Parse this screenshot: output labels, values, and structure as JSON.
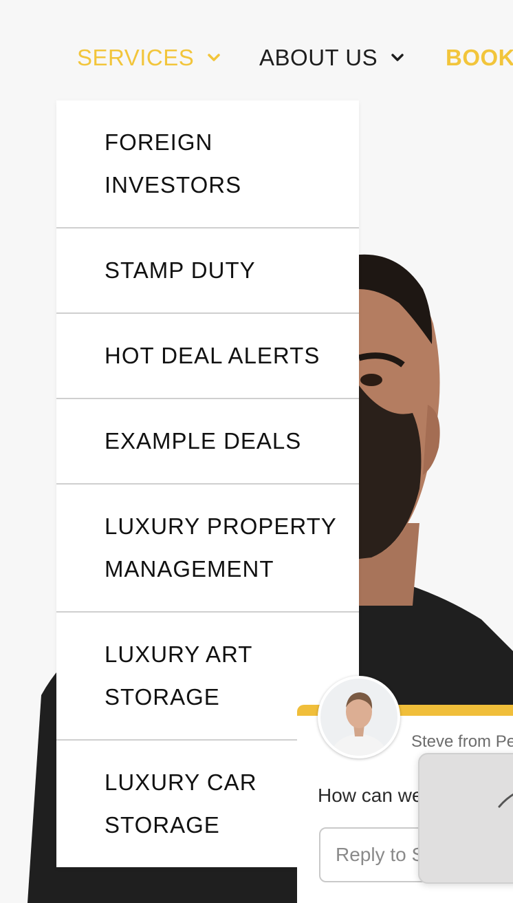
{
  "nav": {
    "services": "SERVICES",
    "about": "ABOUT US",
    "book": "BOOK"
  },
  "services_menu": {
    "items": [
      {
        "line1": "FOREIGN",
        "line2": "INVESTORS"
      },
      {
        "line1": "STAMP DUTY",
        "line2": ""
      },
      {
        "line1": "HOT DEAL ALERTS",
        "line2": ""
      },
      {
        "line1": "EXAMPLE DEALS",
        "line2": ""
      },
      {
        "line1": "LUXURY PROPERTY",
        "line2": "MANAGEMENT"
      },
      {
        "line1": "LUXURY ART",
        "line2": "STORAGE"
      },
      {
        "line1": "LUXURY CAR",
        "line2": "STORAGE"
      }
    ]
  },
  "chat": {
    "from": "Steve from Pe",
    "question": "How can we",
    "reply_placeholder": "Reply to S"
  },
  "colors": {
    "accent": "#f2c53b",
    "nav_text": "#1e1e1e",
    "chat_bar": "#f0be3a"
  },
  "icons": {
    "services_chevron": "chevron-down-icon",
    "about_chevron": "chevron-down-icon",
    "chat_card": "pen-stroke-icon"
  }
}
